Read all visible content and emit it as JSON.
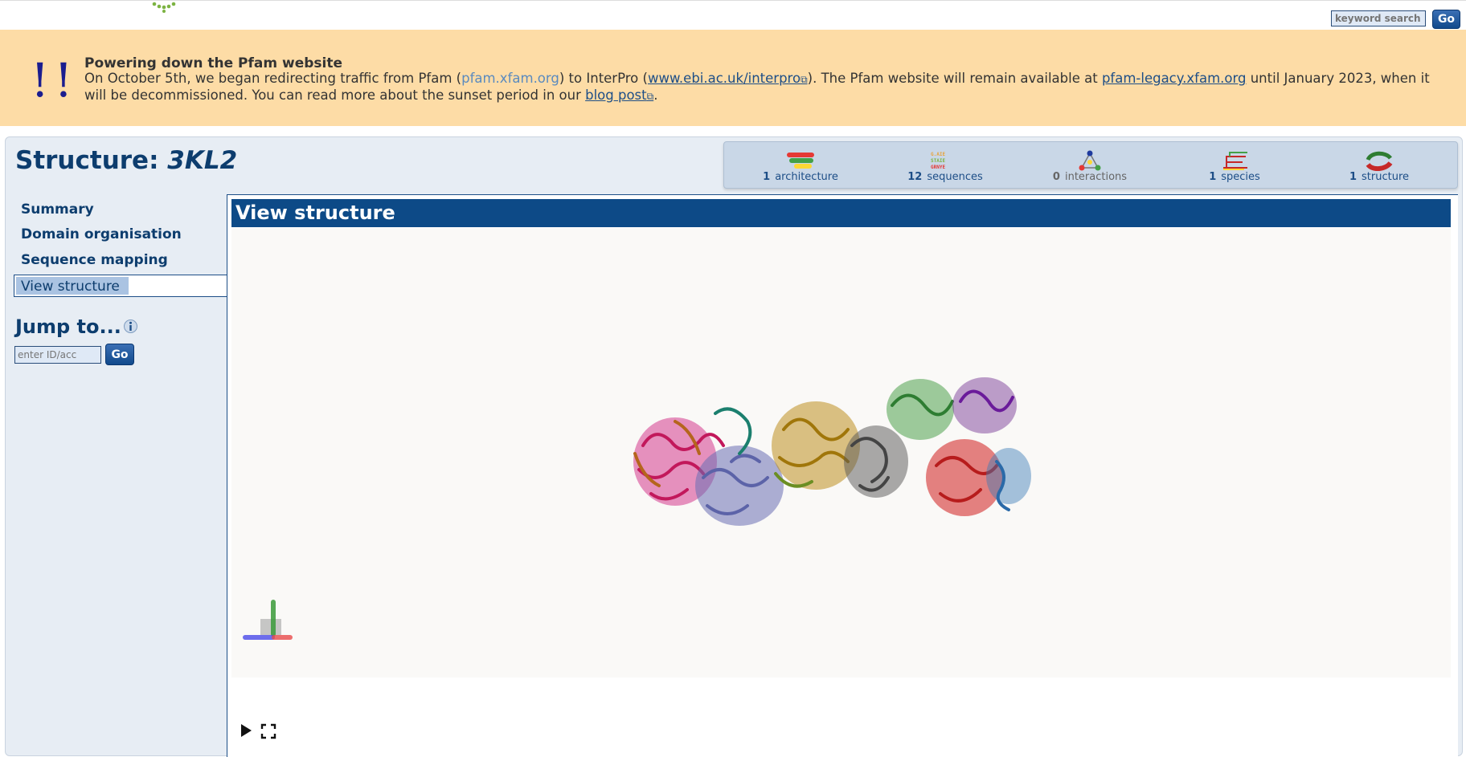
{
  "header": {
    "search_placeholder": "keyword search",
    "search_go": "Go"
  },
  "banner": {
    "bang": "!!",
    "title": "Powering down the Pfam website",
    "text_1": "On October 5th, we began redirecting traffic from Pfam (",
    "link_pfam": "pfam.xfam.org",
    "text_2": ") to InterPro (",
    "link_interpro": "www.ebi.ac.uk/interpro",
    "text_3": "). The Pfam website will remain available at ",
    "link_legacy": "pfam-legacy.xfam.org",
    "text_4": " until January 2023, when it will be decommissioned. You can read more about the sunset period in our ",
    "link_blog": "blog post",
    "text_5": "."
  },
  "page": {
    "title_prefix": "Structure: ",
    "title_id": "3KL2"
  },
  "stats": [
    {
      "count": "1",
      "label": "architecture",
      "icon": "architecture-icon"
    },
    {
      "count": "12",
      "label": "sequences",
      "icon": "sequences-icon"
    },
    {
      "count": "0",
      "label": "interactions",
      "icon": "interactions-icon"
    },
    {
      "count": "1",
      "label": "species",
      "icon": "species-icon"
    },
    {
      "count": "1",
      "label": "structure",
      "icon": "structure-icon"
    }
  ],
  "nav": {
    "items": [
      "Summary",
      "Domain organisation",
      "Sequence mapping",
      "View structure"
    ],
    "active": "View structure"
  },
  "jump": {
    "title": "Jump to...",
    "placeholder": "enter ID/acc",
    "go": "Go"
  },
  "content": {
    "heading": "View structure"
  },
  "colors": {
    "banner_bg": "#fddca6",
    "brand_blue": "#0d4a87",
    "panel_bg": "#e7edf4"
  }
}
